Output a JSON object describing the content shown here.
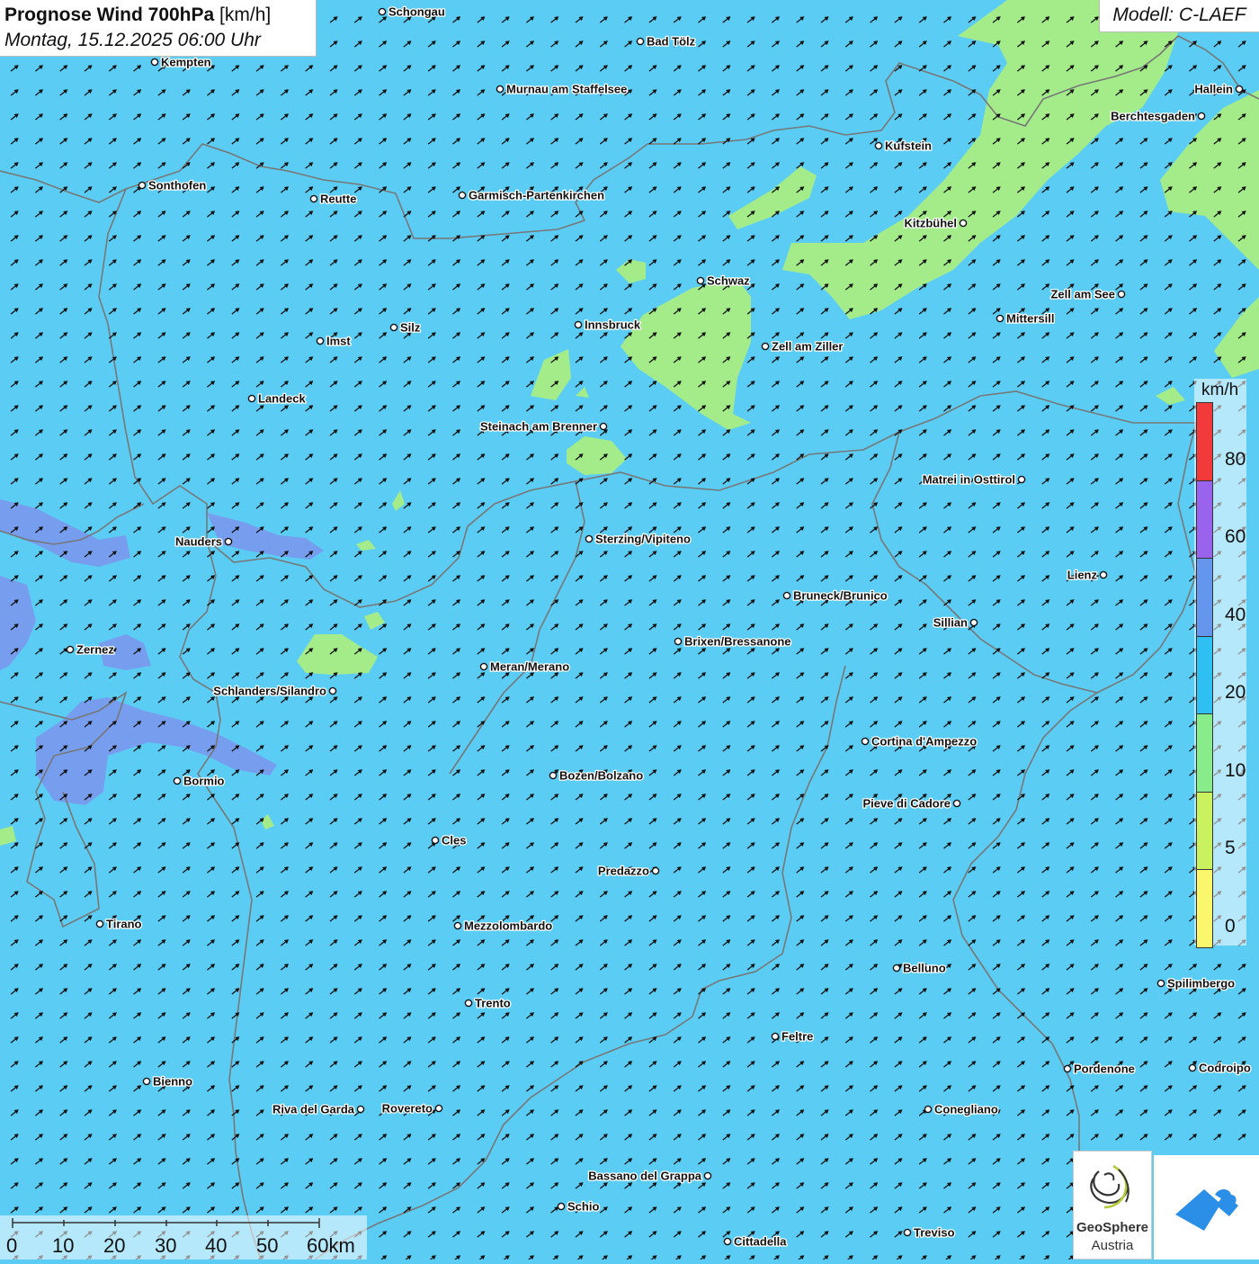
{
  "header": {
    "title_bold": "Prognose Wind 700hPa",
    "title_unit": "[km/h]",
    "datetime": "Montag, 15.12.2025 06:00 Uhr",
    "model": "Modell: C-LAEF"
  },
  "legend": {
    "unit": "km/h",
    "classes": [
      {
        "label": "80",
        "color": "#f23a3a"
      },
      {
        "label": "60",
        "color": "#9a63ee"
      },
      {
        "label": "40",
        "color": "#6496ee"
      },
      {
        "label": "20",
        "color": "#2ec0f2"
      },
      {
        "label": "10",
        "color": "#88ec8a"
      },
      {
        "label": "5",
        "color": "#c9f25e"
      },
      {
        "label": "0",
        "color": "#fbf76d"
      }
    ]
  },
  "scale": {
    "labels": [
      "0",
      "10",
      "20",
      "30",
      "40",
      "50",
      "60km"
    ]
  },
  "colors": {
    "background": "#5bcdf4",
    "calm_area": "#a4ec8a",
    "strong_area": "#7c94ec",
    "border": "#777777",
    "arrow": "#111111"
  },
  "wind": {
    "direction": "south-west"
  },
  "cities": [
    {
      "name": "Schongau",
      "label_side": "right"
    },
    {
      "name": "Bad Tölz",
      "label_side": "right"
    },
    {
      "name": "Kempten",
      "label_side": "right"
    },
    {
      "name": "Murnau am Staffelsee",
      "label_side": "right"
    },
    {
      "name": "Hallein",
      "label_side": "left"
    },
    {
      "name": "Berchtesgaden",
      "label_side": "left"
    },
    {
      "name": "Kufstein",
      "label_side": "right"
    },
    {
      "name": "Sonthofen",
      "label_side": "right"
    },
    {
      "name": "Reutte",
      "label_side": "right"
    },
    {
      "name": "Garmisch-Partenkirchen",
      "label_side": "right"
    },
    {
      "name": "Kitzbühel",
      "label_side": "left"
    },
    {
      "name": "Schwaz",
      "label_side": "right"
    },
    {
      "name": "Zell am See",
      "label_side": "left"
    },
    {
      "name": "Innsbruck",
      "label_side": "right"
    },
    {
      "name": "Silz",
      "label_side": "right"
    },
    {
      "name": "Imst",
      "label_side": "right"
    },
    {
      "name": "Mittersill",
      "label_side": "right"
    },
    {
      "name": "Zell am Ziller",
      "label_side": "right"
    },
    {
      "name": "Landeck",
      "label_side": "right"
    },
    {
      "name": "Steinach am Brenner",
      "label_side": "left"
    },
    {
      "name": "Matrei in Osttirol",
      "label_side": "left"
    },
    {
      "name": "Nauders",
      "label_side": "left"
    },
    {
      "name": "Sterzing/Vipiteno",
      "label_side": "right"
    },
    {
      "name": "Lienz",
      "label_side": "left"
    },
    {
      "name": "Bruneck/Brunico",
      "label_side": "right"
    },
    {
      "name": "Sillian",
      "label_side": "left"
    },
    {
      "name": "Brixen/Bressanone",
      "label_side": "right"
    },
    {
      "name": "Zernez",
      "label_side": "right"
    },
    {
      "name": "Meran/Merano",
      "label_side": "right"
    },
    {
      "name": "Schlanders/Silandro",
      "label_side": "left"
    },
    {
      "name": "Cortina d'Ampezzo",
      "label_side": "right"
    },
    {
      "name": "Bozen/Bolzano",
      "label_side": "right"
    },
    {
      "name": "Bormio",
      "label_side": "right"
    },
    {
      "name": "Pieve di Cadore",
      "label_side": "left"
    },
    {
      "name": "Cles",
      "label_side": "right"
    },
    {
      "name": "Predazzo",
      "label_side": "left"
    },
    {
      "name": "Tirano",
      "label_side": "right"
    },
    {
      "name": "Mezzolombardo",
      "label_side": "right"
    },
    {
      "name": "Belluno",
      "label_side": "right"
    },
    {
      "name": "Spilimbergo",
      "label_side": "right"
    },
    {
      "name": "Trento",
      "label_side": "right"
    },
    {
      "name": "Feltre",
      "label_side": "right"
    },
    {
      "name": "Pordenone",
      "label_side": "right"
    },
    {
      "name": "Codroipo",
      "label_side": "right"
    },
    {
      "name": "Bienno",
      "label_side": "right"
    },
    {
      "name": "Riva del Garda",
      "label_side": "left"
    },
    {
      "name": "Rovereto",
      "label_side": "left"
    },
    {
      "name": "Conegliano",
      "label_side": "right"
    },
    {
      "name": "Bassano del Grappa",
      "label_side": "left"
    },
    {
      "name": "Schio",
      "label_side": "right"
    },
    {
      "name": "Treviso",
      "label_side": "right"
    },
    {
      "name": "Cittadella",
      "label_side": "right"
    }
  ],
  "logos": {
    "geosphere_line1": "GeoSphere",
    "geosphere_line2": "Austria"
  }
}
